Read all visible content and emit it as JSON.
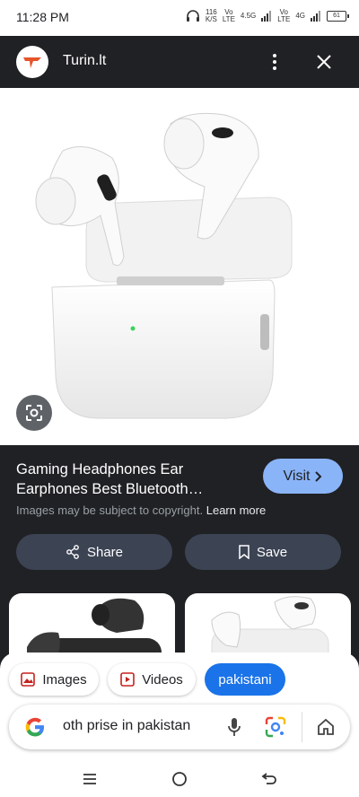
{
  "status_bar": {
    "time": "11:28 PM",
    "net_speed": "116\nK/S",
    "sim1": "Vo\nLTE",
    "sim1_net": "4.5G",
    "sim2": "Vo\nLTE",
    "sim2_net": "4G",
    "battery": "61"
  },
  "top_bar": {
    "site_name": "Turin.lt",
    "more_icon": "more-vert-icon",
    "close_icon": "close-icon"
  },
  "image_viewer": {
    "title": "Gaming Headphones Ear Earphones Best Bluetooth…",
    "visit_label": "Visit",
    "copyright_text": "Images may be subject to copyright.",
    "learn_more": "Learn more",
    "share_label": "Share",
    "save_label": "Save"
  },
  "chips": [
    {
      "label": "Images",
      "icon": "image-icon"
    },
    {
      "label": "Videos",
      "icon": "video-icon"
    },
    {
      "label": "pakistani"
    }
  ],
  "search": {
    "query": "oth prise in pakistan"
  },
  "colors": {
    "dark_bg": "#202124",
    "accent_blue": "#8ab4f8",
    "chip_active": "#1a73e8",
    "button_bg": "#3c4353"
  }
}
